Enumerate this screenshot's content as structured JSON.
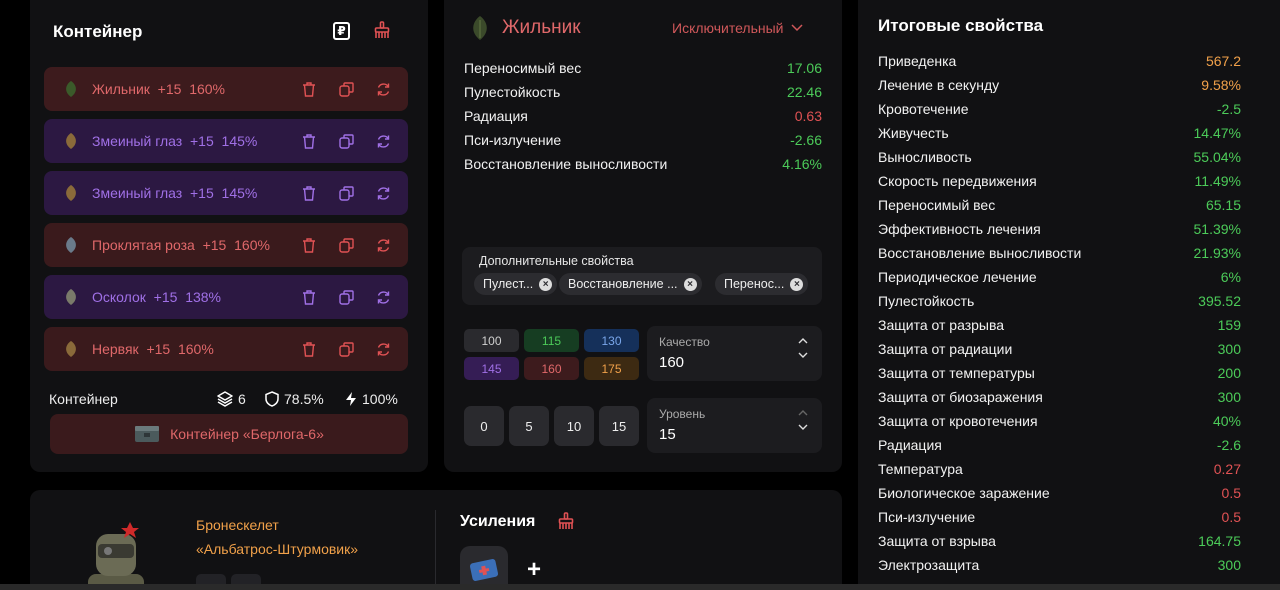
{
  "container": {
    "title": "Контейнер",
    "items": [
      {
        "name": "Жильник",
        "level": "+15",
        "quality": "160%",
        "color": "red"
      },
      {
        "name": "Змеиный глаз",
        "level": "+15",
        "quality": "145%",
        "color": "purple"
      },
      {
        "name": "Змеиный глаз",
        "level": "+15",
        "quality": "145%",
        "color": "purple"
      },
      {
        "name": "Проклятая роза",
        "level": "+15",
        "quality": "160%",
        "color": "red"
      },
      {
        "name": "Осколок",
        "level": "+15",
        "quality": "138%",
        "color": "purple"
      },
      {
        "name": "Нервяк",
        "level": "+15",
        "quality": "160%",
        "color": "red"
      }
    ],
    "footer": {
      "label": "Контейнер",
      "slots": "6",
      "protection": "78.5%",
      "efficiency": "100%"
    },
    "button_label": "Контейнер «Берлога-6»",
    "icons": [
      "ruble-icon",
      "broom-icon",
      "trash-icon",
      "copy-icon",
      "refresh-icon",
      "layers-icon",
      "shield-icon",
      "lightning-icon"
    ]
  },
  "artifact": {
    "name": "Жильник",
    "rarity": "Исключительный",
    "props": [
      {
        "label": "Переносимый вес",
        "value": "17.06",
        "tone": "green"
      },
      {
        "label": "Пулестойкость",
        "value": "22.46",
        "tone": "green"
      },
      {
        "label": "Радиация",
        "value": "0.63",
        "tone": "red"
      },
      {
        "label": "Пси-излучение",
        "value": "-2.66",
        "tone": "green"
      },
      {
        "label": "Восстановление выносливости",
        "value": "4.16%",
        "tone": "green"
      }
    ],
    "extra": {
      "title": "Дополнительные свойства",
      "chips": [
        "Пулест...",
        "Восстановление ...",
        "Перенос..."
      ]
    },
    "quality_buttons": [
      {
        "label": "100",
        "bg": "#2a2a2e",
        "fg": "#d0d0d0"
      },
      {
        "label": "115",
        "bg": "#163d22",
        "fg": "#4ccb59"
      },
      {
        "label": "130",
        "bg": "#15305a",
        "fg": "#7aa6ea"
      },
      {
        "label": "145",
        "bg": "#351d55",
        "fg": "#a070e6"
      },
      {
        "label": "160",
        "bg": "#3d1b1d",
        "fg": "#e0686a"
      },
      {
        "label": "175",
        "bg": "#3d2a12",
        "fg": "#f1a14a"
      }
    ],
    "quality": {
      "label": "Качество",
      "value": "160"
    },
    "level_buttons": [
      "0",
      "5",
      "10",
      "15"
    ],
    "level": {
      "label": "Уровень",
      "value": "15"
    }
  },
  "total": {
    "title": "Итоговые свойства",
    "rows": [
      {
        "label": "Приведенка",
        "value": "567.2",
        "tone": "orange"
      },
      {
        "label": "Лечение в секунду",
        "value": "9.58%",
        "tone": "orange"
      },
      {
        "label": "Кровотечение",
        "value": "-2.5",
        "tone": "green"
      },
      {
        "label": "Живучесть",
        "value": "14.47%",
        "tone": "green"
      },
      {
        "label": "Выносливость",
        "value": "55.04%",
        "tone": "green"
      },
      {
        "label": "Скорость передвижения",
        "value": "11.49%",
        "tone": "green"
      },
      {
        "label": "Переносимый вес",
        "value": "65.15",
        "tone": "green"
      },
      {
        "label": "Эффективность лечения",
        "value": "51.39%",
        "tone": "green"
      },
      {
        "label": "Восстановление выносливости",
        "value": "21.93%",
        "tone": "green"
      },
      {
        "label": "Периодическое лечение",
        "value": "6%",
        "tone": "green"
      },
      {
        "label": "Пулестойкость",
        "value": "395.52",
        "tone": "green"
      },
      {
        "label": "Защита от разрыва",
        "value": "159",
        "tone": "green"
      },
      {
        "label": "Защита от радиации",
        "value": "300",
        "tone": "green"
      },
      {
        "label": "Защита от температуры",
        "value": "200",
        "tone": "green"
      },
      {
        "label": "Защита от биозаражения",
        "value": "300",
        "tone": "green"
      },
      {
        "label": "Защита от кровотечения",
        "value": "40%",
        "tone": "green"
      },
      {
        "label": "Радиация",
        "value": "-2.6",
        "tone": "green"
      },
      {
        "label": "Температура",
        "value": "0.27",
        "tone": "red"
      },
      {
        "label": "Биологическое заражение",
        "value": "0.5",
        "tone": "red"
      },
      {
        "label": "Пси-излучение",
        "value": "0.5",
        "tone": "red"
      },
      {
        "label": "Защита от взрыва",
        "value": "164.75",
        "tone": "green"
      },
      {
        "label": "Электрозащита",
        "value": "300",
        "tone": "green"
      }
    ]
  },
  "suit": {
    "name_line1": "Бронескелет",
    "name_line2": "«Альбатрос-Штурмовик»",
    "boosts_title": "Усиления",
    "add_label": "+"
  },
  "colors": {
    "green": "#4ccb59",
    "red": "#e05254",
    "orange": "#f1a14a",
    "purple": "#a070e6",
    "panel": "#111113"
  }
}
